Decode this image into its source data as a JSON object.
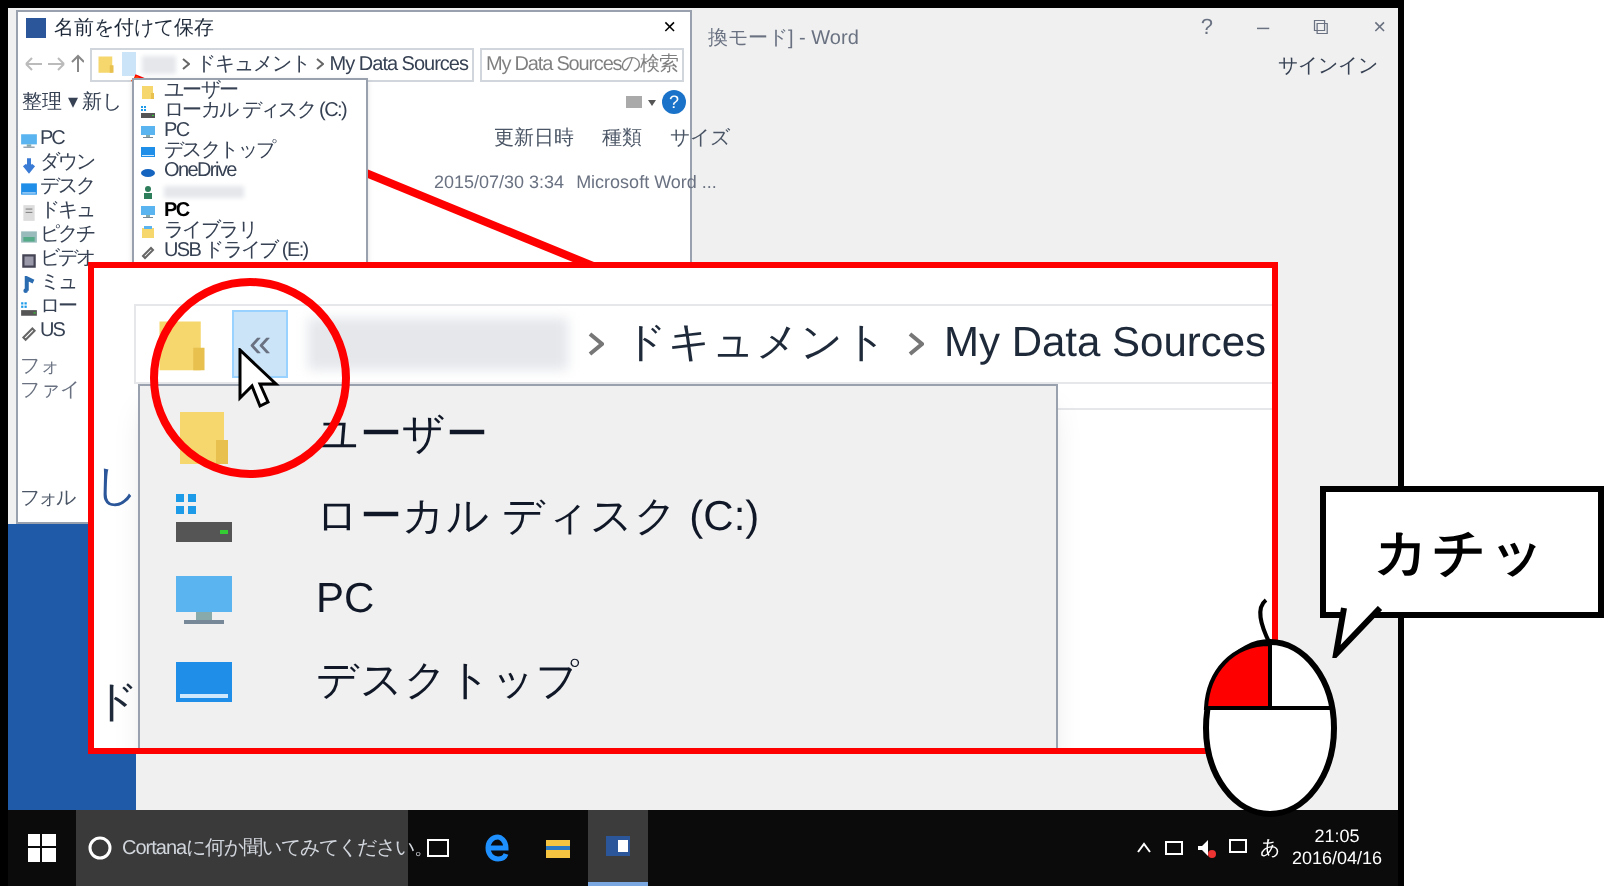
{
  "word_window": {
    "title": "換モード] - Word",
    "controls": [
      "?",
      "–",
      "⧉",
      "×"
    ],
    "sign_in": "サインイン"
  },
  "save_dialog": {
    "title": "名前を付けて保存",
    "close": "×",
    "breadcrumb": [
      "ドキュメント",
      "My Data Sources"
    ],
    "search_placeholder": "My Data Sourcesの検索",
    "toolbar": [
      "整理 ▾",
      "新し"
    ],
    "help": "?",
    "nav_items": [
      {
        "label": "PC",
        "kind": "pc"
      },
      {
        "label": "ダウン",
        "kind": "download"
      },
      {
        "label": "デスク",
        "kind": "desktop"
      },
      {
        "label": "ドキュ",
        "kind": "document"
      },
      {
        "label": "ピクチ",
        "kind": "picture"
      },
      {
        "label": "ビデオ",
        "kind": "video"
      },
      {
        "label": "ミュ",
        "kind": "music"
      },
      {
        "label": "ロー",
        "kind": "disk"
      },
      {
        "label": "US",
        "kind": "usb"
      }
    ],
    "columns": [
      "更新日時",
      "種類",
      "サイズ"
    ],
    "rows": [
      {
        "date": "2015/07/30 3:34",
        "type": "Microsoft Word ..."
      }
    ],
    "bottom_labels": [
      "フォ",
      "ファイ"
    ],
    "folder_toggle": "フォル",
    "dropdown": [
      {
        "label": "ユーザー",
        "kind": "folder",
        "bold": false
      },
      {
        "label": "ローカル ディスク (C:)",
        "kind": "disk",
        "bold": false
      },
      {
        "label": "PC",
        "kind": "pc",
        "bold": false
      },
      {
        "label": "デスクトップ",
        "kind": "desktop",
        "bold": false
      },
      {
        "label": "OneDrive",
        "kind": "cloud",
        "bold": false
      },
      {
        "kind": "user",
        "bold": false
      },
      {
        "label": "PC",
        "kind": "pc",
        "bold": true
      },
      {
        "label": "ライブラリ",
        "kind": "library",
        "bold": false
      },
      {
        "label": "USB ドライブ (E:)",
        "kind": "usb",
        "bold": false
      }
    ]
  },
  "callout": {
    "breadcrumb": [
      "ドキュメント",
      "My Data Sources"
    ],
    "collapse_button": {
      "label": "«",
      "selected": true
    },
    "side_fragments": [
      "し",
      "ド"
    ],
    "dropdown": [
      {
        "label": "ユーザー",
        "kind": "folder"
      },
      {
        "label": "ローカル ディスク (C:)",
        "kind": "disk"
      },
      {
        "label": "PC",
        "kind": "pc"
      },
      {
        "label": "デスクトップ",
        "kind": "desktop"
      }
    ]
  },
  "click_bubble": {
    "text": "カチッ"
  },
  "mouse": {
    "left_button_pressed": true
  },
  "taskbar": {
    "search_placeholder": "Cortanaに何か聞いてみてください。",
    "apps": [
      {
        "kind": "taskview",
        "active": false
      },
      {
        "kind": "edge",
        "active": false
      },
      {
        "kind": "explorer",
        "active": false
      },
      {
        "kind": "word",
        "active": true
      }
    ],
    "ime": "あ",
    "time": "21:05",
    "date": "2016/04/16"
  }
}
